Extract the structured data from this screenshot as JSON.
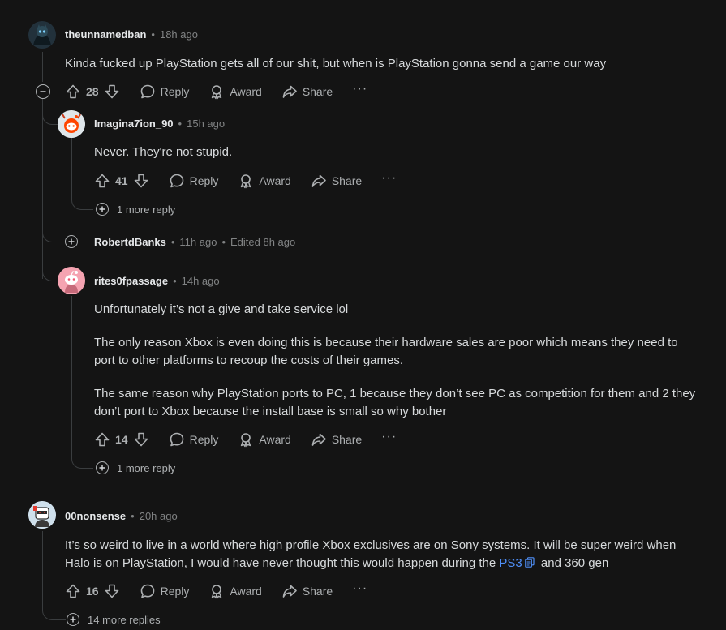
{
  "comments": [
    {
      "username": "theunnamedban",
      "time": "18h ago",
      "body": [
        "Kinda fucked up PlayStation gets all of our shit, but when is PlayStation gonna send a game our way"
      ],
      "score": "28"
    },
    {
      "username": "Imagina7ion_90",
      "time": "15h ago",
      "body": [
        "Never. They're not stupid."
      ],
      "score": "41",
      "more_replies": "1 more reply"
    },
    {
      "username": "RobertdBanks",
      "time": "11h ago",
      "edited": "Edited 8h ago"
    },
    {
      "username": "rites0fpassage",
      "time": "14h ago",
      "body": [
        "Unfortunately it’s not a give and take service lol",
        "The only reason Xbox is even doing this is because their hardware sales are poor which means they need to port to other platforms to recoup the costs of their games.",
        "The same reason why PlayStation ports to PC, 1 because they don’t see PC as competition for them and 2 they don’t port to Xbox because the install base is small so why bother"
      ],
      "score": "14",
      "more_replies": "1 more reply"
    },
    {
      "username": "00nonsense",
      "time": "20h ago",
      "body_before_link": "It’s so weird to live in a world where high profile Xbox exclusives are on Sony systems. It will be super weird when Halo is on PlayStation, I would have never thought this would happen during the",
      "link_text": "PS3",
      "body_after_link": "and 360 gen",
      "score": "16",
      "more_replies": "14 more replies"
    }
  ],
  "actions": {
    "reply": "Reply",
    "award": "Award",
    "share": "Share",
    "more": "···"
  },
  "separator": "•",
  "colors": {
    "background": "#141414",
    "text": "#d7dadc",
    "muted": "#818384",
    "thread_line": "#3a3d3f",
    "link": "#4f8ff7"
  },
  "icons": [
    "upvote-icon",
    "downvote-icon",
    "reply-icon",
    "award-icon",
    "share-icon",
    "plus-icon",
    "minus-icon",
    "copy-icon"
  ]
}
